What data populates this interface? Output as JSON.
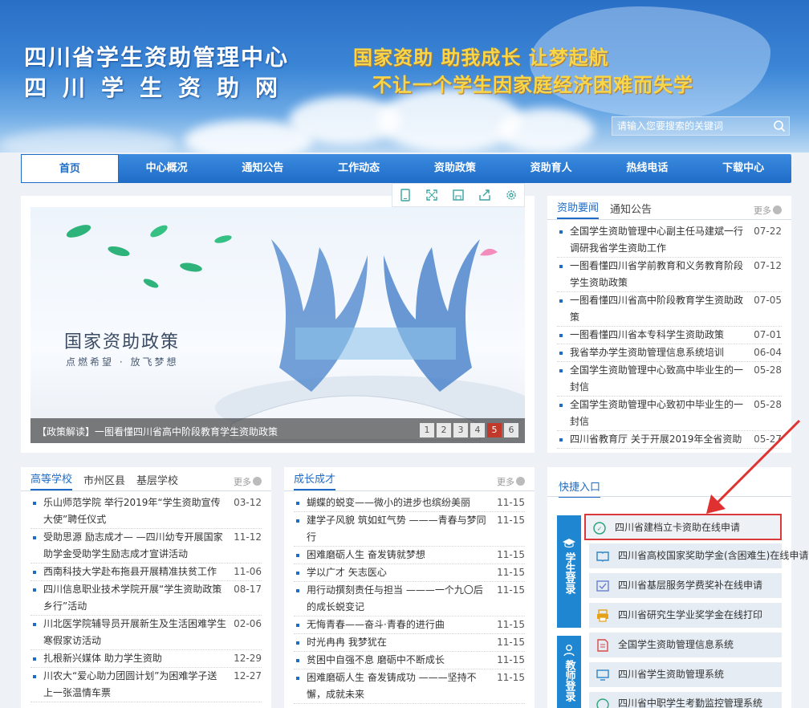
{
  "header": {
    "title": "四川省学生资助管理中心",
    "subtitle": "四川学生资助网",
    "slogan1": "国家资助 助我成长 让梦起航",
    "slogan2": "不让一个学生因家庭经济困难而失学",
    "search_placeholder": "请输入您要搜索的关键词"
  },
  "nav": [
    "首页",
    "中心概况",
    "通知公告",
    "工作动态",
    "资助政策",
    "资助育人",
    "热线电话",
    "下载中心"
  ],
  "slider": {
    "slide_title": "国家资助政策",
    "slide_subtitle": "点燃希望 · 放飞梦想",
    "caption": "【政策解读】一图看懂四川省高中阶段教育学生资助政策",
    "pages": [
      "1",
      "2",
      "3",
      "4",
      "5",
      "6"
    ],
    "current_page": 5
  },
  "news_panel": {
    "tabs": [
      "资助要闻",
      "通知公告"
    ],
    "more": "更多",
    "items": [
      {
        "title": "全国学生资助管理中心副主任马建斌一行调研我省学生资助工作",
        "date": "07-22"
      },
      {
        "title": "一图看懂四川省学前教育和义务教育阶段学生资助政策",
        "date": "07-12"
      },
      {
        "title": "一图看懂四川省高中阶段教育学生资助政策",
        "date": "07-05"
      },
      {
        "title": "一图看懂四川省本专科学生资助政策",
        "date": "07-01"
      },
      {
        "title": "我省举办学生资助管理信息系统培训",
        "date": "06-04"
      },
      {
        "title": "全国学生资助管理中心致高中毕业生的一封信",
        "date": "05-28"
      },
      {
        "title": "全国学生资助管理中心致初中毕业生的一封信",
        "date": "05-28"
      },
      {
        "title": "四川省教育厅 关于开展2019年全省资助",
        "date": "05-27"
      }
    ]
  },
  "school_panel": {
    "tabs": [
      "高等学校",
      "市州区县",
      "基层学校"
    ],
    "more": "更多",
    "items": [
      {
        "title": "乐山师范学院 举行2019年“学生资助宣传大使”聘任仪式",
        "date": "03-12"
      },
      {
        "title": "受助思源 励志成才— —四川幼专开展国家助学金受助学生励志成才宣讲活动",
        "date": "11-12"
      },
      {
        "title": "西南科技大学赴布拖县开展精准扶贫工作",
        "date": "11-06"
      },
      {
        "title": "四川信息职业技术学院开展“学生资助政策乡行”活动",
        "date": "08-17"
      },
      {
        "title": "川北医学院辅导员开展新生及生活困难学生寒假家访活动",
        "date": "02-06"
      },
      {
        "title": "扎根新兴媒体 助力学生资助",
        "date": "12-29"
      },
      {
        "title": "川农大“爱心助力团圆计划”为困难学子送上一张温情车票",
        "date": "12-27"
      }
    ]
  },
  "growth_panel": {
    "tabs": [
      "成长成才"
    ],
    "more": "更多",
    "items": [
      {
        "title": "蝴蝶的蜕变——微小的进步也缤纷美丽",
        "date": "11-15"
      },
      {
        "title": "建学子风貌 筑如虹气势 ———青春与梦同行",
        "date": "11-15"
      },
      {
        "title": "困难磨砺人生 奋发铸就梦想",
        "date": "11-15"
      },
      {
        "title": "学以广才 矢志医心",
        "date": "11-15"
      },
      {
        "title": "用行动撰刻责任与担当 ———一个九〇后的成长蜕变记",
        "date": "11-15"
      },
      {
        "title": "无悔青春——奋斗·青春的进行曲",
        "date": "11-15"
      },
      {
        "title": "时光冉冉 我梦犹在",
        "date": "11-15"
      },
      {
        "title": "贫困中自强不息 磨砺中不断成长",
        "date": "11-15"
      },
      {
        "title": "困难磨砺人生 奋发铸成功 ———坚持不懈，成就未来",
        "date": "11-15"
      }
    ]
  },
  "quick_panel": {
    "title": "快捷入口",
    "student_login": "学生登录",
    "teacher_login": "教师登录",
    "items": [
      "四川省建档立卡资助在线申请",
      "四川省高校国家奖助学金(含困难生)在线申请",
      "四川省基层服务学费奖补在线申请",
      "四川省研究生学业奖学金在线打印",
      "全国学生资助管理信息系统",
      "四川省学生资助管理系统",
      "四川省中职学生考勤监控管理系统"
    ]
  }
}
